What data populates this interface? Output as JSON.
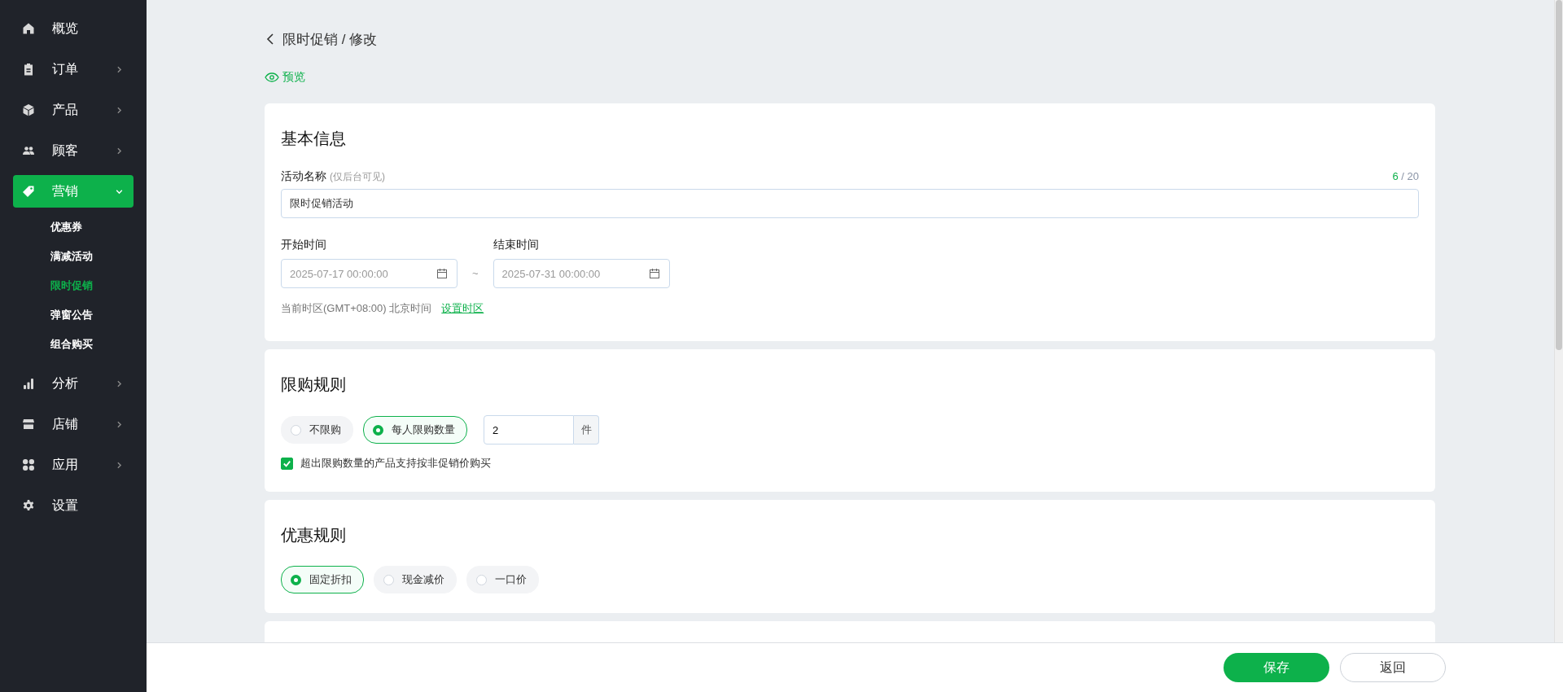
{
  "sidebar": {
    "items": [
      {
        "label": "概览",
        "kind": "link",
        "selected": false
      },
      {
        "label": "订单",
        "kind": "group",
        "expanded": false,
        "selected": false
      },
      {
        "label": "产品",
        "kind": "group",
        "expanded": false,
        "selected": false
      },
      {
        "label": "顾客",
        "kind": "group",
        "expanded": false,
        "selected": false
      },
      {
        "label": "营销",
        "kind": "group",
        "expanded": true,
        "selected": true,
        "children": [
          {
            "label": "优惠券",
            "selected": false
          },
          {
            "label": "满减活动",
            "selected": false
          },
          {
            "label": "限时促销",
            "selected": true
          },
          {
            "label": "弹窗公告",
            "selected": false
          },
          {
            "label": "组合购买",
            "selected": false
          }
        ]
      },
      {
        "label": "分析",
        "kind": "group",
        "expanded": false,
        "selected": false
      },
      {
        "label": "店铺",
        "kind": "group",
        "expanded": false,
        "selected": false
      },
      {
        "label": "应用",
        "kind": "group",
        "expanded": false,
        "selected": false
      },
      {
        "label": "设置",
        "kind": "link",
        "selected": false
      }
    ]
  },
  "breadcrumb": "限时促销 / 修改",
  "preview_link": "预览",
  "basic_info": {
    "title": "基本信息",
    "name_field": {
      "label": "活动名称",
      "hint": "(仅后台可见)",
      "value": "限时促销活动",
      "count": "6",
      "max": "/ 20"
    },
    "start": {
      "label": "开始时间",
      "placeholder": "2025-07-17 00:00:00"
    },
    "separator": "~",
    "end": {
      "label": "结束时间",
      "placeholder": "2025-07-31 00:00:00"
    },
    "timezone": "当前时区(GMT+08:00) 北京时间",
    "timezone_link": "设置时区"
  },
  "purchase_limit": {
    "title": "限购规则",
    "options": [
      {
        "label": "不限购",
        "selected": false
      },
      {
        "label": "每人限购数量",
        "selected": true
      }
    ],
    "quantity": {
      "value": "2",
      "unit": "件"
    },
    "checkbox": {
      "label": "超出限购数量的产品支持按非促销价购买",
      "checked": true
    }
  },
  "discount_rule": {
    "title": "优惠规则",
    "options": [
      {
        "label": "固定折扣",
        "selected": true
      },
      {
        "label": "现金减价",
        "selected": false
      },
      {
        "label": "一口价",
        "selected": false
      }
    ]
  },
  "footer": {
    "buttons": [
      {
        "label": "保存",
        "kind": "primary"
      },
      {
        "label": "返回",
        "kind": "secondary"
      }
    ]
  }
}
